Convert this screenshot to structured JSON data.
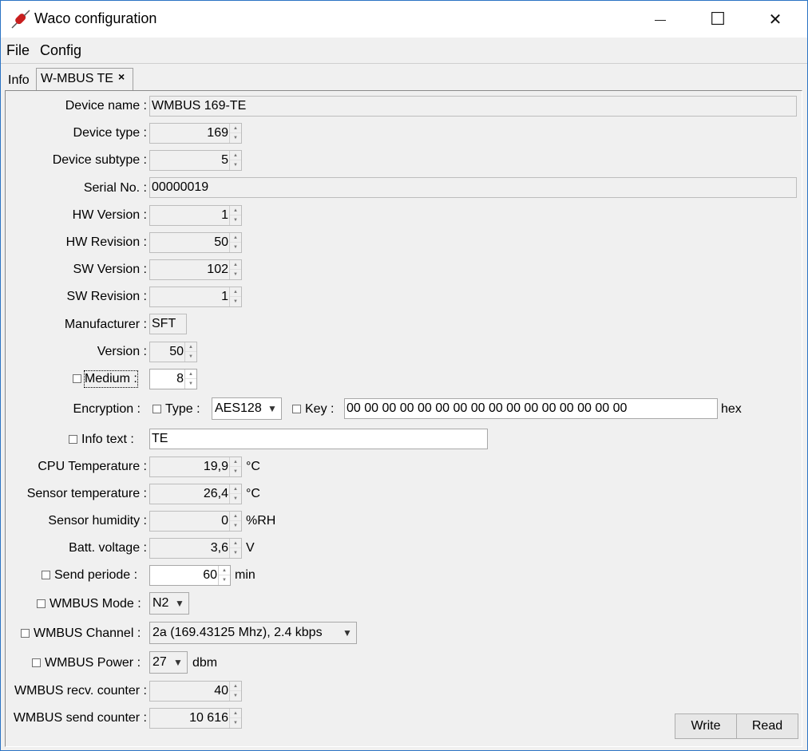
{
  "window": {
    "title": "Waco configuration",
    "minimize_glyph": "—",
    "maximize_glyph": "☐",
    "close_glyph": "✕"
  },
  "menu": {
    "file": "File",
    "config": "Config"
  },
  "tabs": {
    "info": "Info",
    "wmbus_te": "W-MBUS TE",
    "close_glyph": "×"
  },
  "form": {
    "device_name": {
      "label": "Device name :",
      "value": "WMBUS 169-TE"
    },
    "device_type": {
      "label": "Device type :",
      "value": "169"
    },
    "device_subtype": {
      "label": "Device subtype :",
      "value": "5"
    },
    "serial_no": {
      "label": "Serial No. :",
      "value": "00000019"
    },
    "hw_version": {
      "label": "HW Version :",
      "value": "1"
    },
    "hw_revision": {
      "label": "HW Revision :",
      "value": "50"
    },
    "sw_version": {
      "label": "SW Version :",
      "value": "102"
    },
    "sw_revision": {
      "label": "SW Revision :",
      "value": "1"
    },
    "manufacturer": {
      "label": "Manufacturer :",
      "value": "SFT"
    },
    "version": {
      "label": "Version :",
      "value": "50"
    },
    "medium": {
      "label": "Medium :",
      "value": "8"
    },
    "encryption": {
      "label": "Encryption :",
      "type_label": "Type :",
      "type_value": "AES128",
      "key_label": "Key :",
      "key_value": "00 00 00 00 00 00 00 00 00 00 00 00 00 00 00 00",
      "key_unit": "hex"
    },
    "info_text": {
      "label": "Info text :",
      "value": "TE"
    },
    "cpu_temperature": {
      "label": "CPU Temperature :",
      "value": "19,9",
      "unit": "°C"
    },
    "sensor_temperature": {
      "label": "Sensor temperature :",
      "value": "26,4",
      "unit": "°C"
    },
    "sensor_humidity": {
      "label": "Sensor humidity :",
      "value": "0",
      "unit": "%RH"
    },
    "batt_voltage": {
      "label": "Batt. voltage :",
      "value": "3,6",
      "unit": "V"
    },
    "send_periode": {
      "label": "Send periode :",
      "value": "60",
      "unit": "min"
    },
    "wmbus_mode": {
      "label": "WMBUS Mode :",
      "value": "N2"
    },
    "wmbus_channel": {
      "label": "WMBUS Channel :",
      "value": "2a (169.43125 Mhz), 2.4 kbps"
    },
    "wmbus_power": {
      "label": "WMBUS Power :",
      "value": "27",
      "unit": "dbm"
    },
    "wmbus_recv_counter": {
      "label": "WMBUS recv. counter :",
      "value": "40"
    },
    "wmbus_send_counter": {
      "label": "WMBUS send counter :",
      "value": "10 616"
    }
  },
  "buttons": {
    "write": "Write",
    "read": "Read"
  },
  "icons": {
    "app": "red-resistor-icon",
    "spin_up": "▲",
    "spin_down": "▼",
    "dropdown": "▼"
  }
}
